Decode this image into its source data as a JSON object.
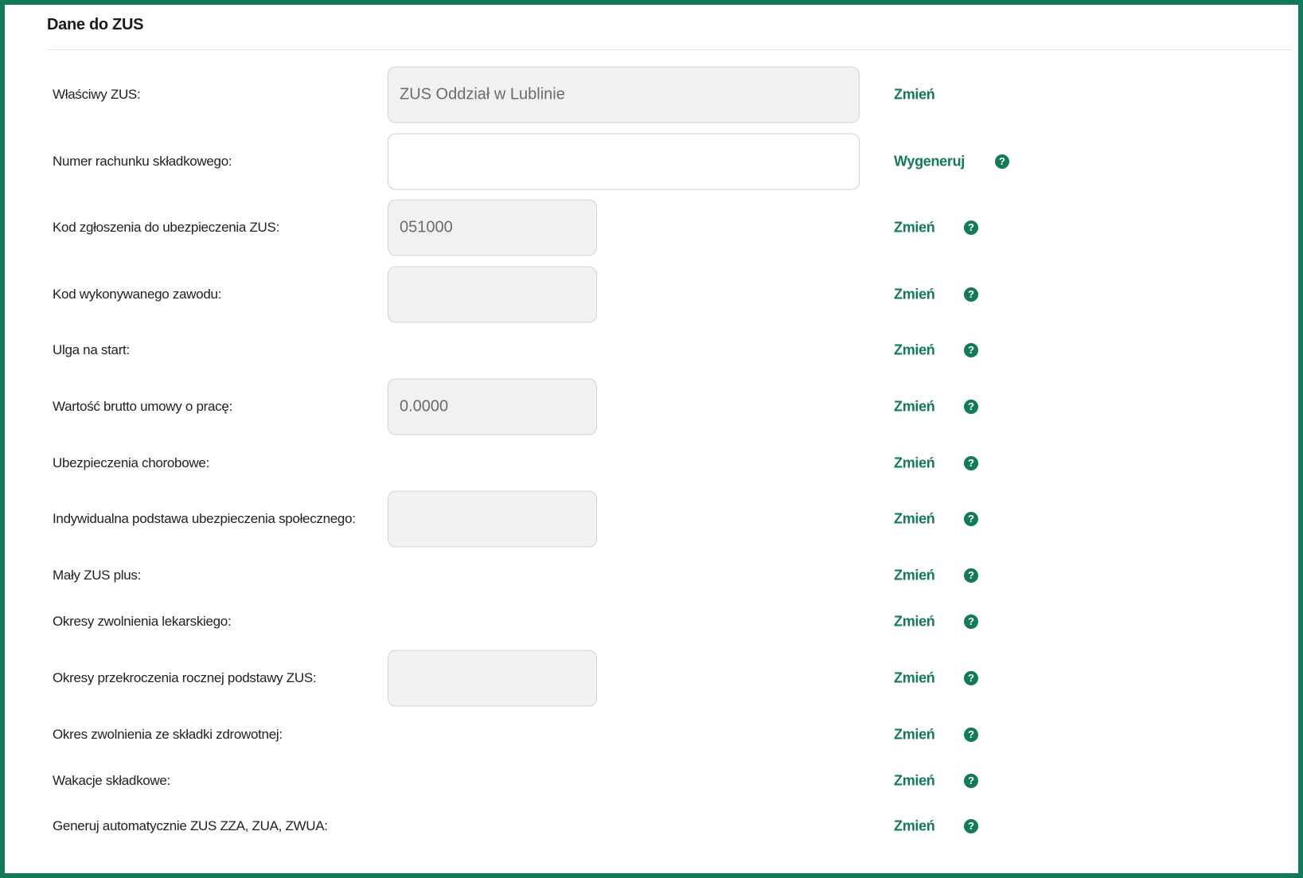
{
  "section": {
    "title": "Dane do ZUS"
  },
  "rows": [
    {
      "label": "Właściwy ZUS:",
      "value": "ZUS Oddział w Lublinie",
      "action": "Zmień"
    },
    {
      "label": "Numer rachunku składkowego:",
      "value": "",
      "action": "Wygeneruj"
    },
    {
      "label": "Kod zgłoszenia do ubezpieczenia ZUS:",
      "value": "051000",
      "action": "Zmień"
    },
    {
      "label": "Kod wykonywanego zawodu:",
      "value": "",
      "action": "Zmień"
    },
    {
      "label": "Ulga na start:",
      "action": "Zmień"
    },
    {
      "label": "Wartość brutto umowy o pracę:",
      "value": "0.0000",
      "action": "Zmień"
    },
    {
      "label": "Ubezpieczenia chorobowe:",
      "action": "Zmień"
    },
    {
      "label": "Indywidualna podstawa ubezpieczenia społecznego:",
      "value": "",
      "action": "Zmień"
    },
    {
      "label": "Mały ZUS plus:",
      "action": "Zmień"
    },
    {
      "label": "Okresy zwolnienia lekarskiego:",
      "action": "Zmień"
    },
    {
      "label": "Okresy przekroczenia rocznej podstawy ZUS:",
      "value": "",
      "action": "Zmień"
    },
    {
      "label": "Okres zwolnienia ze składki zdrowotnej:",
      "action": "Zmień"
    },
    {
      "label": "Wakacje składkowe:",
      "action": "Zmień"
    },
    {
      "label": "Generuj automatycznie ZUS ZZA, ZUA, ZWUA:",
      "action": "Zmień"
    }
  ],
  "help_glyph": "?",
  "icons": {
    "help": "help-circle-icon"
  },
  "colors": {
    "accent": "#117a5b",
    "frame": "#127a5a",
    "field_bg": "#f1f1f1"
  }
}
